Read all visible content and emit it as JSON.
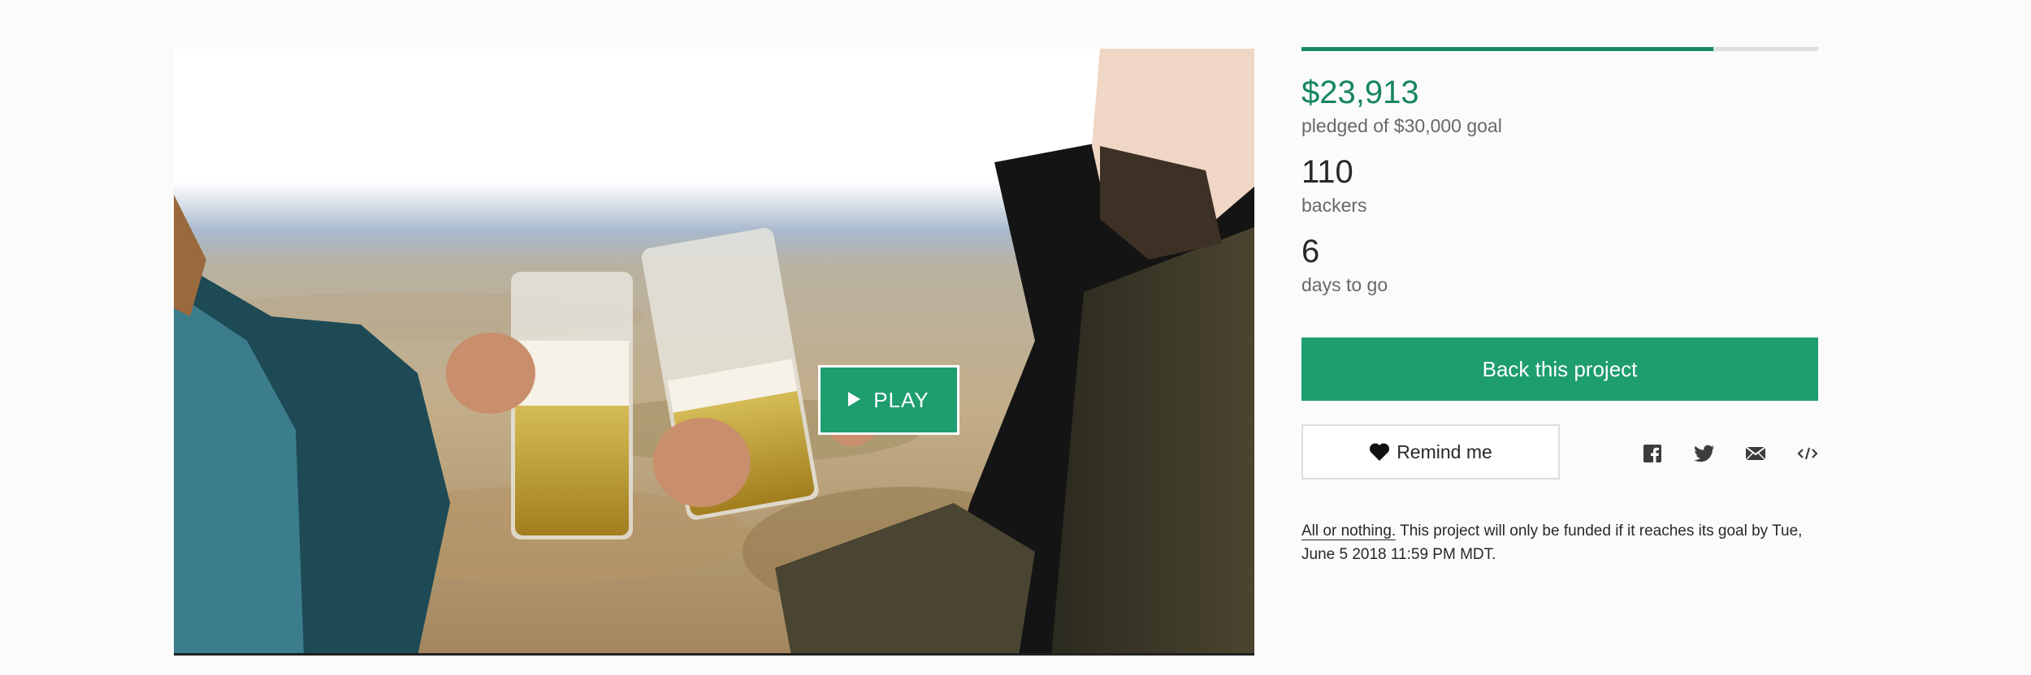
{
  "video": {
    "play_label": "PLAY",
    "play_icon": "play-triangle-icon"
  },
  "funding": {
    "progress_fraction": 0.797,
    "accent_color": "#1e9d6f",
    "pledged_amount": "$23,913",
    "pledged_goal_text": "pledged of $30,000 goal",
    "backers_count": "110",
    "backers_label": "backers",
    "days_count": "6",
    "days_label": "days to go"
  },
  "actions": {
    "back_label": "Back this project",
    "remind_label": "Remind me",
    "remind_icon": "heart-icon",
    "share_icons": [
      "facebook-icon",
      "twitter-icon",
      "email-icon",
      "embed-icon"
    ]
  },
  "fine_print": {
    "all_or_nothing": "All or nothing.",
    "text": " This project will only be funded if it reaches its goal by Tue, June 5 2018 11:59 PM MDT."
  }
}
